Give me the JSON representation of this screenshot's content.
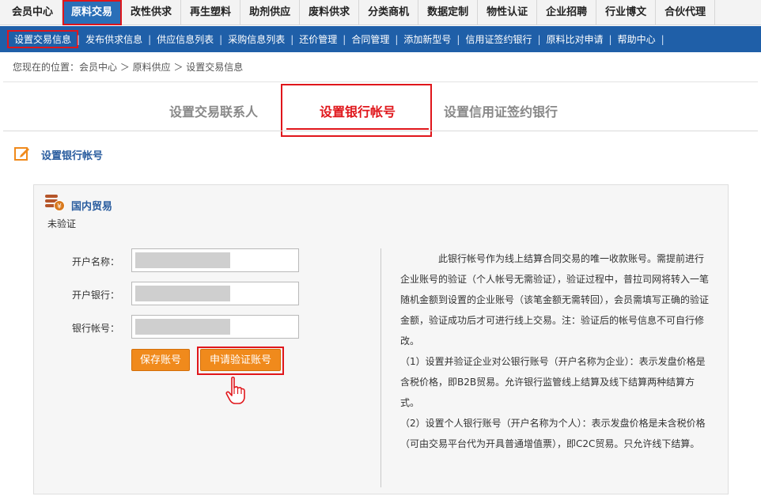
{
  "topnav": {
    "items": [
      "会员中心",
      "原料交易",
      "改性供求",
      "再生塑料",
      "助剂供应",
      "废料供求",
      "分类商机",
      "数据定制",
      "物性认证",
      "企业招聘",
      "行业博文",
      "合伙代理"
    ],
    "active_index": 1
  },
  "subnav": {
    "items": [
      "设置交易信息",
      "发布供求信息",
      "供应信息列表",
      "采购信息列表",
      "还价管理",
      "合同管理",
      "添加新型号",
      "信用证签约银行",
      "原料比对申请",
      "帮助中心"
    ],
    "active_index": 0
  },
  "breadcrumb": {
    "text": "您现在的位置：会员中心 ＞ 原料供应 ＞ 设置交易信息"
  },
  "tabs": {
    "items": [
      "设置交易联系人",
      "设置银行帐号",
      "设置信用证签约银行"
    ],
    "active_index": 1
  },
  "section": {
    "title": "设置银行帐号"
  },
  "panel": {
    "trade_title": "国内贸易",
    "status": "未验证",
    "fields": [
      {
        "label": "开户名称：",
        "value": ""
      },
      {
        "label": "开户银行：",
        "value": ""
      },
      {
        "label": "银行帐号：",
        "value": ""
      }
    ],
    "buttons": {
      "save": "保存账号",
      "verify": "申请验证账号"
    },
    "info": {
      "p1": "此银行帐号作为线上结算合同交易的唯一收款账号。需提前进行企业账号的验证（个人帐号无需验证），验证过程中，普拉司网将转入一笔随机金额到设置的企业账号（该笔金额无需转回），会员需填写正确的验证金额，验证成功后才可进行线上交易。注：验证后的帐号信息不可自行修改。",
      "p2": "（1）设置并验证企业对公银行账号（开户名称为企业）：表示发盘价格是含税价格，即B2B贸易。允许银行监管线上结算及线下结算两种结算方式。",
      "p3": "（2）设置个人银行账号（开户名称为个人）：表示发盘价格是未含税价格（可由交易平台代为开具普通增值票），即C2C贸易。只允许线下结算。"
    }
  },
  "colors": {
    "accent_blue": "#1f5fa8",
    "highlight_red": "#e0161b",
    "button_orange": "#f08a1c",
    "title_blue": "#2a5d9f"
  },
  "icons": {
    "section": "edit-icon",
    "trade": "coin-stack-icon",
    "cursor": "hand-pointer-icon"
  }
}
